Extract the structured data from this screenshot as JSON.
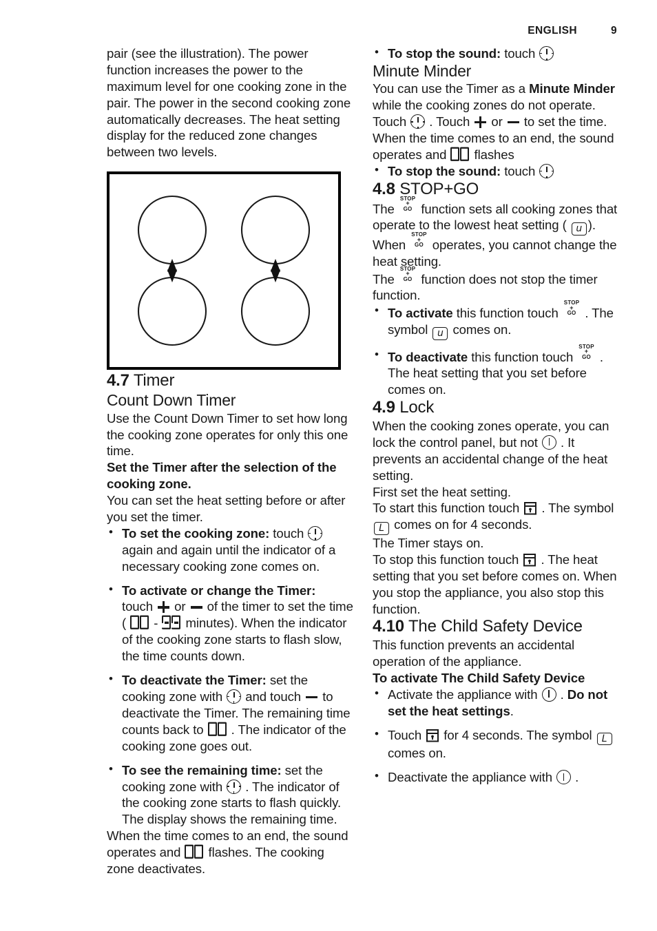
{
  "header": {
    "language": "ENGLISH",
    "page_number": "9"
  },
  "left_column": {
    "intro_paragraph": "pair (see the illustration). The power function increases the power to the maximum level for one cooking zone in the pair. The power in the second cooking zone automatically decreases. The heat setting display for the reduced zone changes between two levels.",
    "figure": {
      "name": "hob-cooking-zone-pairs-diagram",
      "description": "Hob outline with four cooking zone circles arranged in two vertical pairs, each pair linked by a double-headed arrow",
      "zone_count": "4",
      "arrow_count": "2"
    },
    "section_4_7": {
      "number": "4.7",
      "title": "Timer",
      "subheading": "Count Down Timer",
      "para_1": "Use the Count Down Timer to set how long the cooking zone operates for only this one time.",
      "para_2_bold": "Set the Timer after the selection of the cooking zone.",
      "para_3": "You can set the heat setting before or after you set the timer.",
      "bullets": [
        {
          "lead": "To set the cooking zone:",
          "text_1": "touch",
          "icon_1": "clock-icon",
          "text_2": "again and again until the indicator of a necessary cooking zone comes on."
        },
        {
          "lead": "To activate or change the Timer:",
          "text_1": "touch",
          "icon_1": "plus-icon",
          "text_2": "or",
          "icon_2": "minus-icon",
          "text_3": "of the timer to set the time (",
          "digits_from": "00",
          "digits_sep": "-",
          "digits_to": "99",
          "text_4": "minutes). When the indicator of the cooking zone starts to flash slow, the time counts down."
        },
        {
          "lead": "To deactivate the Timer:",
          "text_1": "set the cooking zone with",
          "icon_1": "clock-icon",
          "text_2": "and touch",
          "icon_2": "minus-icon",
          "text_3": "to deactivate the Timer. The remaining time counts back to",
          "digits_1": "00",
          "text_4": ". The indicator of the cooking zone goes out."
        },
        {
          "lead": "To see the remaining time:",
          "text_1": "set the cooking zone with",
          "icon_1": "clock-icon",
          "text_2": ". The indicator of the cooking zone starts to flash quickly. The display shows the remaining time."
        }
      ],
      "closing_text_1": "When the time comes to an end, the sound operates and",
      "closing_digits": "00",
      "closing_text_2": "flashes. The cooking zone deactivates."
    }
  },
  "right_column": {
    "stop_sound_bullet_top": {
      "lead": "To stop the sound:",
      "text_1": "touch",
      "icon_1": "clock-icon"
    },
    "minute_minder": {
      "subheading": "Minute Minder",
      "text_1": "You can use the Timer as a",
      "bold_1": "Minute Minder",
      "text_2": "while the cooking zones do not operate. Touch",
      "icon_1": "clock-icon",
      "text_3": ". Touch",
      "icon_2": "plus-icon",
      "text_4": "or",
      "icon_3": "minus-icon",
      "text_5": "to set the time. When the time comes to an end, the sound operates and",
      "digits_1": "00",
      "text_6": "flashes",
      "bullet": {
        "lead": "To stop the sound:",
        "text_1": "touch",
        "icon_1": "clock-icon"
      }
    },
    "section_4_8": {
      "number": "4.8",
      "title": "STOP+GO",
      "icon_lines": [
        "STOP",
        "+",
        "GO"
      ],
      "para_1_a": "The",
      "para_1_b": "function sets all cooking zones that operate to the lowest heat setting (",
      "para_1_symbol": "u",
      "para_1_c": ").",
      "para_2_a": "When",
      "para_2_b": "operates, you cannot change the heat setting.",
      "para_3_a": "The",
      "para_3_b": "function does not stop the timer function.",
      "bullets": [
        {
          "lead": "To activate",
          "text_1": "this function touch",
          "icon_1": "stop-go-icon",
          "text_2": ". The symbol",
          "symbol_1": "u",
          "text_3": "comes on."
        },
        {
          "lead": "To deactivate",
          "text_1": "this function touch",
          "icon_1": "stop-go-icon",
          "text_2": ". The heat setting that you set before comes on."
        }
      ]
    },
    "section_4_9": {
      "number": "4.9",
      "title": "Lock",
      "para_1_a": "When the cooking zones operate, you can lock the control panel, but not",
      "icon_1": "power-icon",
      "para_1_b": ". It prevents an accidental change of the heat setting.",
      "para_2": "First set the heat setting.",
      "para_3_a": "To start this function touch",
      "icon_2": "lock-icon",
      "para_3_b": ". The symbol",
      "symbol_1": "L",
      "para_3_c": "comes on for 4 seconds.",
      "para_4": "The Timer stays on.",
      "para_5_a": "To stop this function touch",
      "icon_3": "lock-icon",
      "para_5_b": ". The heat setting that you set before comes on. When you stop the appliance, you also stop this function."
    },
    "section_4_10": {
      "number": "4.10",
      "title": "The Child Safety Device",
      "para_1": "This function prevents an accidental operation of the appliance.",
      "subheading_bold": "To activate The Child Safety Device",
      "bullets": [
        {
          "text_1": "Activate the appliance with",
          "icon_1": "power-icon",
          "text_2": ".",
          "bold_1": "Do not set the heat settings",
          "text_3": "."
        },
        {
          "text_1": "Touch",
          "icon_1": "lock-icon",
          "text_2": "for 4 seconds. The symbol",
          "symbol_1": "L",
          "text_3": "comes on."
        },
        {
          "text_1": "Deactivate the appliance with",
          "icon_1": "power-icon",
          "text_2": "."
        }
      ]
    }
  },
  "colors": {
    "text": "#1a1a1a",
    "background": "#ffffff",
    "rule": "#000000"
  }
}
